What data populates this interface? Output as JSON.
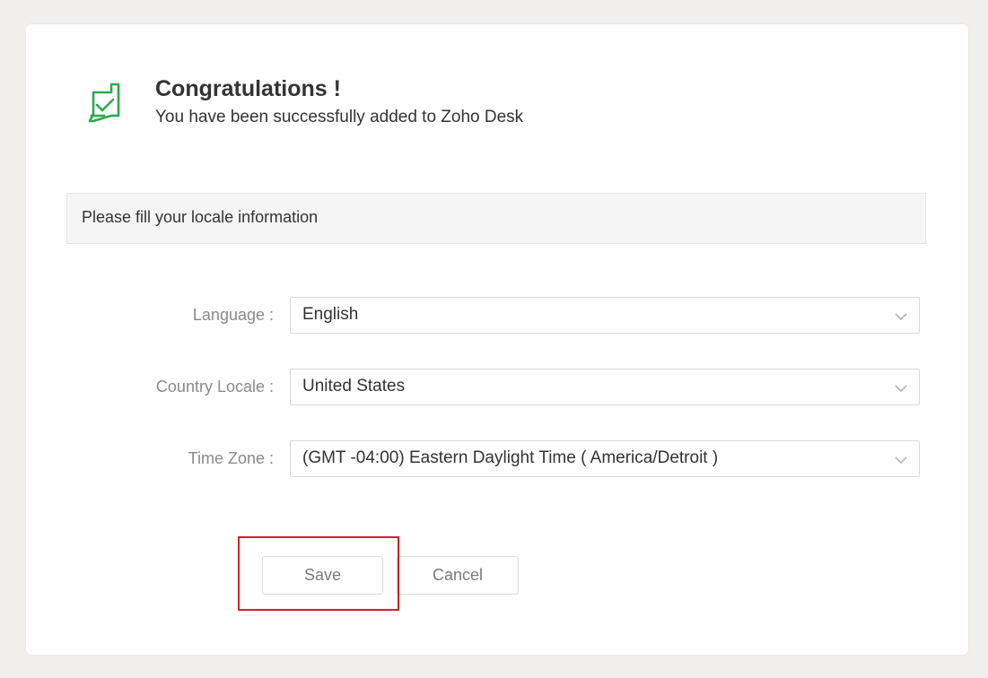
{
  "header": {
    "icon": "chat-check-icon",
    "icon_color": "#2ea84f",
    "title": "Congratulations !",
    "subtitle": "You have been successfully added to Zoho Desk"
  },
  "info_bar": {
    "text": "Please fill your locale information"
  },
  "form": {
    "language": {
      "label": "Language :",
      "value": "English"
    },
    "country_locale": {
      "label": "Country Locale :",
      "value": "United States"
    },
    "time_zone": {
      "label": "Time Zone :",
      "value": "(GMT -04:00) Eastern Daylight Time ( America/Detroit )"
    }
  },
  "actions": {
    "save_label": "Save",
    "cancel_label": "Cancel",
    "highlight_color": "#d81f1f"
  }
}
